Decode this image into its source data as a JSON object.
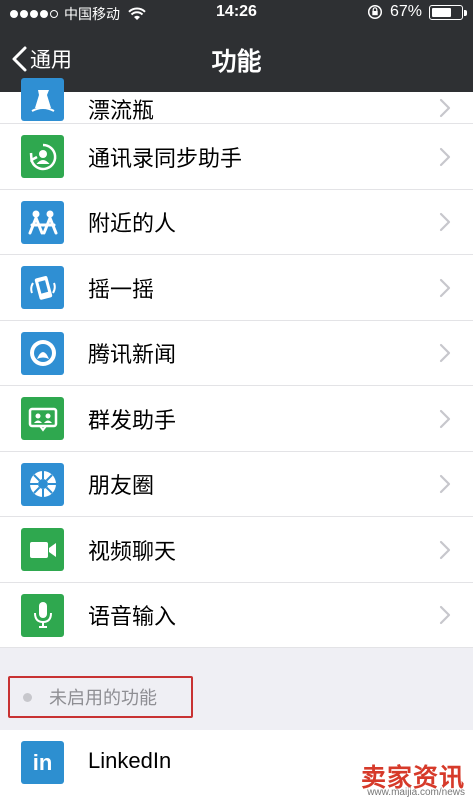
{
  "status_bar": {
    "carrier": "中国移动",
    "time": "14:26",
    "battery_percent": "67%",
    "battery_level": 0.67
  },
  "nav": {
    "back_label": "通用",
    "title": "功能"
  },
  "features": [
    {
      "label": "漂流瓶",
      "icon": "drift-bottle-icon",
      "color": "#2f8fd3"
    },
    {
      "label": "通讯录同步助手",
      "icon": "contacts-sync-icon",
      "color": "#2fa84f"
    },
    {
      "label": "附近的人",
      "icon": "people-nearby-icon",
      "color": "#2f8fd3"
    },
    {
      "label": "摇一摇",
      "icon": "shake-icon",
      "color": "#2f8fd3"
    },
    {
      "label": "腾讯新闻",
      "icon": "tencent-news-icon",
      "color": "#2f8fd3"
    },
    {
      "label": "群发助手",
      "icon": "broadcast-assistant-icon",
      "color": "#2fa84f"
    },
    {
      "label": "朋友圈",
      "icon": "moments-icon",
      "color": "#2f8fd3"
    },
    {
      "label": "视频聊天",
      "icon": "video-chat-icon",
      "color": "#2fa84f"
    },
    {
      "label": "语音输入",
      "icon": "voice-input-icon",
      "color": "#2fa84f"
    }
  ],
  "disabled_section": {
    "label": "未启用的功能"
  },
  "disabled_features": [
    {
      "label": "LinkedIn",
      "icon_text": "in",
      "icon": "linkedin-icon",
      "color": "#2d8fd0"
    }
  ],
  "watermark": {
    "brand": "卖家资讯",
    "url": "www.maijia.com/news"
  }
}
